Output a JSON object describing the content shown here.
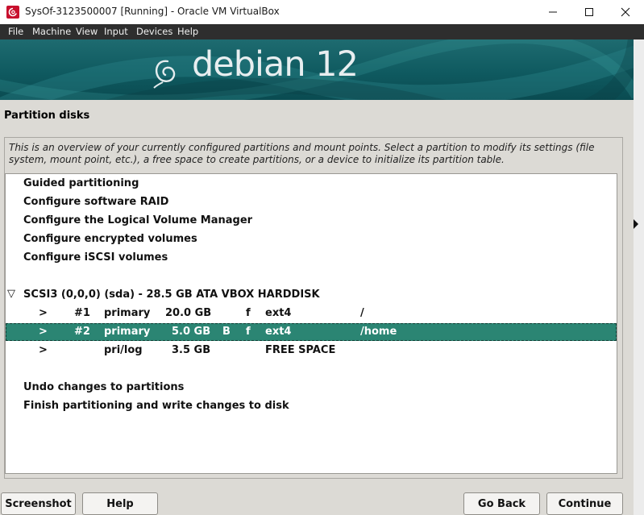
{
  "window": {
    "title": "SysOf-3123500007 [Running] - Oracle VM VirtualBox"
  },
  "menubar": [
    "File",
    "Machine",
    "View",
    "Input",
    "Devices",
    "Help"
  ],
  "banner": {
    "text": "debian 12"
  },
  "page": {
    "title": "Partition disks",
    "description_line1": "This is an overview of your currently configured partitions and mount points. Select a partition to modify its settings (file",
    "description_line2": "system, mount point, etc.), a free space to create partitions, or a device to initialize its partition table."
  },
  "list": {
    "options": [
      "Guided partitioning",
      "Configure software RAID",
      "Configure the Logical Volume Manager",
      "Configure encrypted volumes",
      "Configure iSCSI volumes"
    ],
    "disk": {
      "expander": "▽",
      "label": "SCSI3 (0,0,0) (sda) - 28.5 GB ATA VBOX HARDDISK"
    },
    "partitions": [
      {
        "arrow": ">",
        "num": "#1",
        "type": "primary",
        "size": "20.0 GB",
        "boot": "",
        "fmt": "f",
        "fs": "ext4",
        "mount": "/"
      },
      {
        "arrow": ">",
        "num": "#2",
        "type": "primary",
        "size": "5.0 GB",
        "boot": "B",
        "fmt": "f",
        "fs": "ext4",
        "mount": "/home"
      },
      {
        "arrow": ">",
        "num": "",
        "type": "pri/log",
        "size": "3.5 GB",
        "boot": "",
        "fmt": "",
        "fs": "FREE SPACE",
        "mount": ""
      }
    ],
    "actions": [
      "Undo changes to partitions",
      "Finish partitioning and write changes to disk"
    ]
  },
  "buttons": {
    "screenshot": "Screenshot",
    "help": "Help",
    "go_back": "Go Back",
    "continue": "Continue"
  },
  "colors": {
    "selection": "#2b8573",
    "menubar": "#2e2e2e",
    "banner": "#0f5a60"
  }
}
